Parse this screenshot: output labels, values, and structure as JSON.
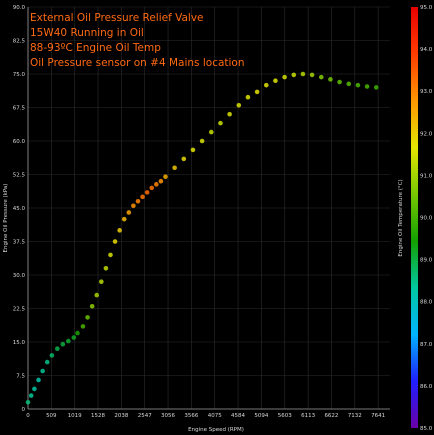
{
  "chart_data": {
    "type": "scatter",
    "title": "",
    "xlabel": "Engine Speed (RPM)",
    "ylabel": "Engine Oil Pressure (kPa)",
    "colorbar_label": "Engine Oil Temperature (°C)",
    "annotations": [
      "External Oil Pressure Relief Valve",
      "15W40 Running in Oil",
      "88-93ºC Engine Oil Temp",
      "Oil Pressure sensor on #4 Mains location"
    ],
    "x_ticks": [
      "0",
      "509",
      "1019",
      "1528",
      "2038",
      "2547",
      "3056",
      "3566",
      "4075",
      "4584",
      "5094",
      "5603",
      "6113",
      "6622",
      "7132",
      "7641"
    ],
    "xlim": [
      0,
      7900
    ],
    "y_ticks": [
      "0",
      "7.5",
      "15.0",
      "22.5",
      "30.0",
      "37.5",
      "45.0",
      "52.5",
      "60.0",
      "67.5",
      "75.0",
      "82.5",
      "90.0"
    ],
    "ylim": [
      0,
      90
    ],
    "colorbar_ticks": [
      "85.0",
      "86.0",
      "87.0",
      "88.0",
      "89.0",
      "90.0",
      "91.0",
      "92.0",
      "93.0",
      "94.0",
      "95.0"
    ],
    "color_range": [
      85,
      95
    ],
    "colormap": [
      "#6a00a8",
      "#1f1fff",
      "#00b4ff",
      "#00c8a0",
      "#14a000",
      "#78c800",
      "#e6e600",
      "#ff9600",
      "#ff3c00",
      "#e60000"
    ],
    "grid": true,
    "series": [
      {
        "points": [
          [
            0,
            1.5,
            88.6
          ],
          [
            70,
            3.0,
            88.4
          ],
          [
            140,
            4.5,
            88.3
          ],
          [
            230,
            6.5,
            88.2
          ],
          [
            320,
            8.5,
            88.4
          ],
          [
            420,
            10.5,
            88.5
          ],
          [
            520,
            12.0,
            88.7
          ],
          [
            640,
            13.5,
            88.9
          ],
          [
            760,
            14.5,
            89.0
          ],
          [
            880,
            15.2,
            89.1
          ],
          [
            1000,
            16.0,
            89.2
          ],
          [
            1080,
            17.0,
            89.5
          ],
          [
            1200,
            18.5,
            90.0
          ],
          [
            1300,
            20.5,
            90.4
          ],
          [
            1400,
            23.0,
            90.8
          ],
          [
            1500,
            25.5,
            91.0
          ],
          [
            1600,
            28.5,
            91.2
          ],
          [
            1700,
            31.5,
            91.3
          ],
          [
            1800,
            34.5,
            91.5
          ],
          [
            1900,
            37.5,
            91.8
          ],
          [
            2000,
            40.0,
            92.0
          ],
          [
            2100,
            42.5,
            92.3
          ],
          [
            2200,
            44.0,
            92.6
          ],
          [
            2300,
            45.5,
            92.8
          ],
          [
            2400,
            46.5,
            93.0
          ],
          [
            2500,
            47.5,
            93.2
          ],
          [
            2600,
            48.5,
            93.3
          ],
          [
            2700,
            49.5,
            93.2
          ],
          [
            2800,
            50.3,
            93.0
          ],
          [
            2900,
            51.0,
            92.8
          ],
          [
            3000,
            52.0,
            92.5
          ],
          [
            3200,
            54.0,
            92.1
          ],
          [
            3400,
            56.0,
            91.8
          ],
          [
            3600,
            58.0,
            91.6
          ],
          [
            3800,
            60.0,
            91.5
          ],
          [
            4000,
            62.0,
            91.4
          ],
          [
            4200,
            64.0,
            91.4
          ],
          [
            4400,
            66.0,
            91.5
          ],
          [
            4600,
            68.0,
            91.5
          ],
          [
            4800,
            69.8,
            91.6
          ],
          [
            5000,
            71.0,
            91.7
          ],
          [
            5200,
            72.5,
            91.6
          ],
          [
            5400,
            73.5,
            91.6
          ],
          [
            5600,
            74.3,
            91.5
          ],
          [
            5800,
            74.8,
            91.4
          ],
          [
            6000,
            75.0,
            91.2
          ],
          [
            6200,
            74.8,
            91.0
          ],
          [
            6400,
            74.3,
            90.7
          ],
          [
            6600,
            73.8,
            90.5
          ],
          [
            6800,
            73.2,
            90.3
          ],
          [
            7000,
            72.8,
            90.2
          ],
          [
            7200,
            72.5,
            90.1
          ],
          [
            7400,
            72.2,
            90.0
          ],
          [
            7600,
            72.0,
            89.9
          ]
        ]
      }
    ]
  }
}
